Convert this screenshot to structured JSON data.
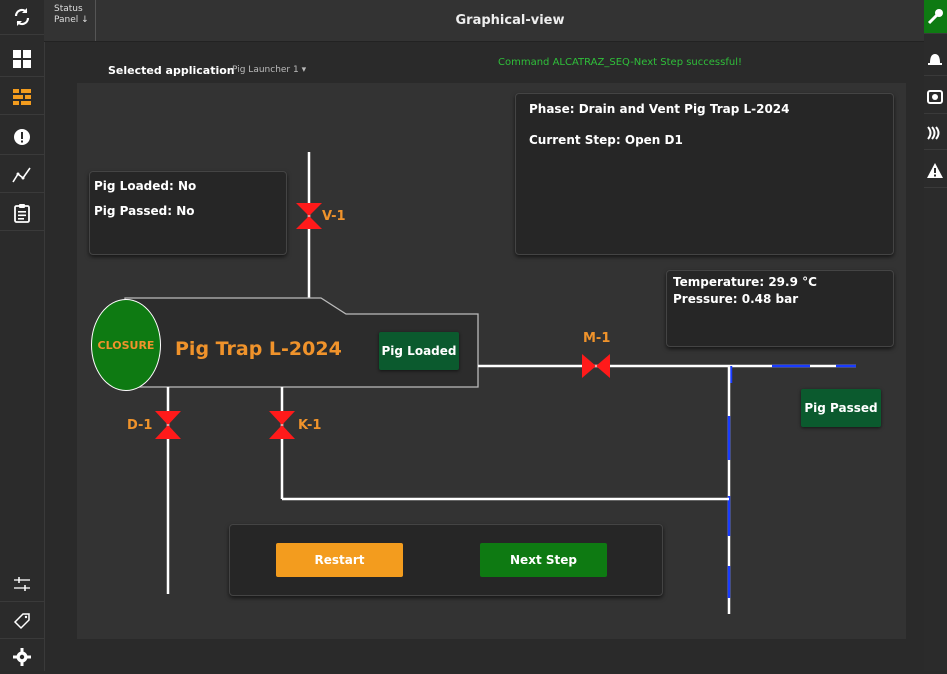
{
  "top_bar": {
    "status_panel": "Status Panel ↓",
    "title": "Graphical-view"
  },
  "left_nav": {
    "icons": [
      "refresh-icon",
      "dashboard-grid-icon",
      "sequence-icon",
      "alert-icon",
      "trend-chart-icon",
      "clipboard-icon",
      "sliders-icon",
      "tag-icon",
      "gear-icon"
    ]
  },
  "right_nav": {
    "icons": [
      "wrench-icon",
      "bell-icon",
      "camera-icon",
      "signal-icon",
      "warning-icon"
    ]
  },
  "header": {
    "selected_app_label": "Selected application",
    "selected_app_value": "Pig Launcher 1 ▾",
    "command_message": "Command ALCATRAZ_SEQ-Next Step successful!"
  },
  "pig_status": {
    "loaded_label": "Pig Loaded:",
    "loaded_value": "No",
    "passed_label": "Pig Passed:",
    "passed_value": "No"
  },
  "phase_box": {
    "phase_label": "Phase:",
    "phase_value": "Drain and Vent Pig Trap L-2024",
    "step_label": "Current Step:",
    "step_value": "Open D1"
  },
  "process_box": {
    "temp_label": "Temperature:",
    "temp_value": "29.9 °C",
    "pressure_label": "Pressure:",
    "pressure_value": "0.48 bar"
  },
  "trap": {
    "closure": "CLOSURE",
    "name": "Pig Trap L-2024",
    "loaded_badge": "Pig Loaded",
    "passed_badge": "Pig Passed"
  },
  "valves": {
    "v1": "V-1",
    "m1": "M-1",
    "d1": "D-1",
    "k1": "K-1"
  },
  "actions": {
    "restart": "Restart",
    "next_step": "Next Step"
  },
  "colors": {
    "accent_orange": "#f39c1e",
    "valve_red": "#ff1a1a",
    "success_green": "#0e7a12",
    "message_green": "#2fbf3a",
    "flow_blue": "#1a3cff"
  }
}
